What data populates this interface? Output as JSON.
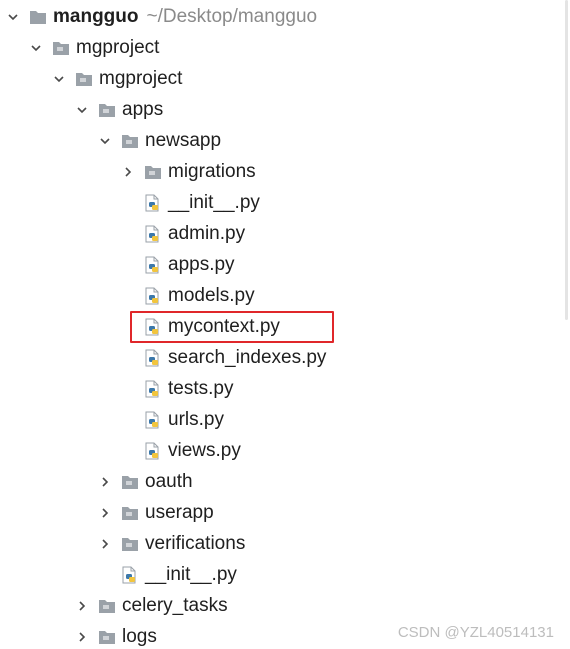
{
  "root": {
    "label": "mangguo",
    "path": "~/Desktop/mangguo"
  },
  "items": [
    {
      "label": "mgproject",
      "depth": 1,
      "kind": "folder",
      "expanded": true
    },
    {
      "label": "mgproject",
      "depth": 2,
      "kind": "folder",
      "expanded": true
    },
    {
      "label": "apps",
      "depth": 3,
      "kind": "folder",
      "expanded": true
    },
    {
      "label": "newsapp",
      "depth": 4,
      "kind": "folder",
      "expanded": true
    },
    {
      "label": "migrations",
      "depth": 5,
      "kind": "folder",
      "expanded": false
    },
    {
      "label": "__init__.py",
      "depth": 5,
      "kind": "py"
    },
    {
      "label": "admin.py",
      "depth": 5,
      "kind": "py"
    },
    {
      "label": "apps.py",
      "depth": 5,
      "kind": "py"
    },
    {
      "label": "models.py",
      "depth": 5,
      "kind": "py"
    },
    {
      "label": "mycontext.py",
      "depth": 5,
      "kind": "py",
      "highlighted": true
    },
    {
      "label": "search_indexes.py",
      "depth": 5,
      "kind": "py"
    },
    {
      "label": "tests.py",
      "depth": 5,
      "kind": "py"
    },
    {
      "label": "urls.py",
      "depth": 5,
      "kind": "py"
    },
    {
      "label": "views.py",
      "depth": 5,
      "kind": "py"
    },
    {
      "label": "oauth",
      "depth": 4,
      "kind": "folder",
      "expanded": false
    },
    {
      "label": "userapp",
      "depth": 4,
      "kind": "folder",
      "expanded": false
    },
    {
      "label": "verifications",
      "depth": 4,
      "kind": "folder",
      "expanded": false
    },
    {
      "label": "__init__.py",
      "depth": 4,
      "kind": "py"
    },
    {
      "label": "celery_tasks",
      "depth": 3,
      "kind": "folder",
      "expanded": false
    },
    {
      "label": "logs",
      "depth": 3,
      "kind": "folder",
      "expanded": false
    }
  ],
  "watermark": "CSDN @YZL40514131",
  "colors": {
    "highlight_border": "#e0272a",
    "folder_icon": "#9aa1a8",
    "python_blue": "#3c78aa",
    "python_yellow": "#f2c53d",
    "text": "#1f1f1f",
    "path_text": "#8a8a8a"
  }
}
